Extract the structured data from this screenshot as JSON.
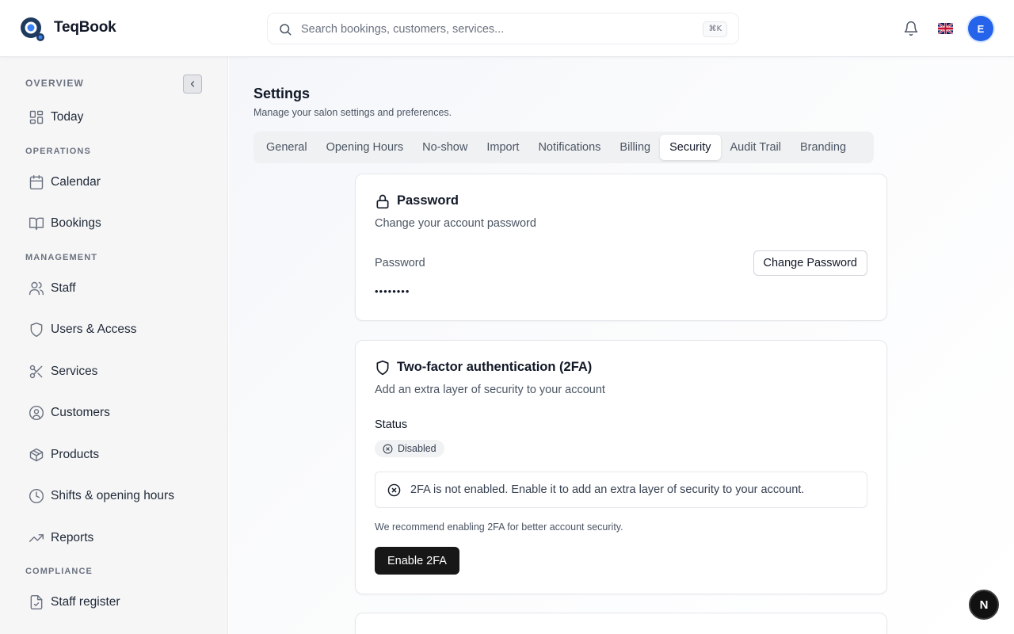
{
  "app": {
    "brand": "TeqBook",
    "logo_icon": "teqbook-logo-icon",
    "accent_color": "#2563eb"
  },
  "header": {
    "search": {
      "placeholder": "Search bookings, customers, services...",
      "value": "",
      "shortcut": "⌘K",
      "icon": "search-icon"
    },
    "notifications_icon": "bell-icon",
    "language_flag": "uk-flag-icon",
    "avatar_initial": "E",
    "avatar_color": "#2563eb"
  },
  "sidebar": {
    "collapse_icon": "chevron-left-icon",
    "sections": [
      {
        "label": "OVERVIEW"
      },
      {
        "label": "OPERATIONS"
      },
      {
        "label": "MANAGEMENT"
      },
      {
        "label": "COMPLIANCE"
      }
    ],
    "items": [
      {
        "label": "Today",
        "icon": "dashboard-icon"
      },
      {
        "label": "Calendar",
        "icon": "calendar-icon"
      },
      {
        "label": "Bookings",
        "icon": "book-icon"
      },
      {
        "label": "Staff",
        "icon": "users-icon"
      },
      {
        "label": "Users & Access",
        "icon": "shield-icon"
      },
      {
        "label": "Services",
        "icon": "scissors-icon"
      },
      {
        "label": "Customers",
        "icon": "user-circle-icon"
      },
      {
        "label": "Products",
        "icon": "package-icon"
      },
      {
        "label": "Shifts & opening hours",
        "icon": "clock-icon"
      },
      {
        "label": "Reports",
        "icon": "trending-up-icon"
      },
      {
        "label": "Staff register",
        "icon": "file-check-icon"
      }
    ]
  },
  "main": {
    "title": "Settings",
    "subtitle": "Manage your salon settings and preferences.",
    "tabs": [
      {
        "label": "General"
      },
      {
        "label": "Opening Hours"
      },
      {
        "label": "No-show"
      },
      {
        "label": "Import"
      },
      {
        "label": "Notifications"
      },
      {
        "label": "Billing"
      },
      {
        "label": "Security",
        "active": true
      },
      {
        "label": "Audit Trail"
      },
      {
        "label": "Branding"
      }
    ],
    "password_card": {
      "icon": "lock-icon",
      "title": "Password",
      "description": "Change your account password",
      "field_label": "Password",
      "masked_value": "••••••••",
      "button_label": "Change Password"
    },
    "twofa_card": {
      "icon": "shield-icon",
      "title": "Two-factor authentication (2FA)",
      "description": "Add an extra layer of security to your account",
      "status_label": "Status",
      "status_badge": "Disabled",
      "status_icon": "x-circle-icon",
      "alert_icon": "x-circle-icon",
      "alert_text": "2FA is not enabled. Enable it to add an extra layer of security to your account.",
      "recommendation": "We recommend enabling 2FA for better account security.",
      "button_label": "Enable 2FA"
    }
  },
  "fab": {
    "label": "N",
    "icon": "nextjs-icon"
  }
}
